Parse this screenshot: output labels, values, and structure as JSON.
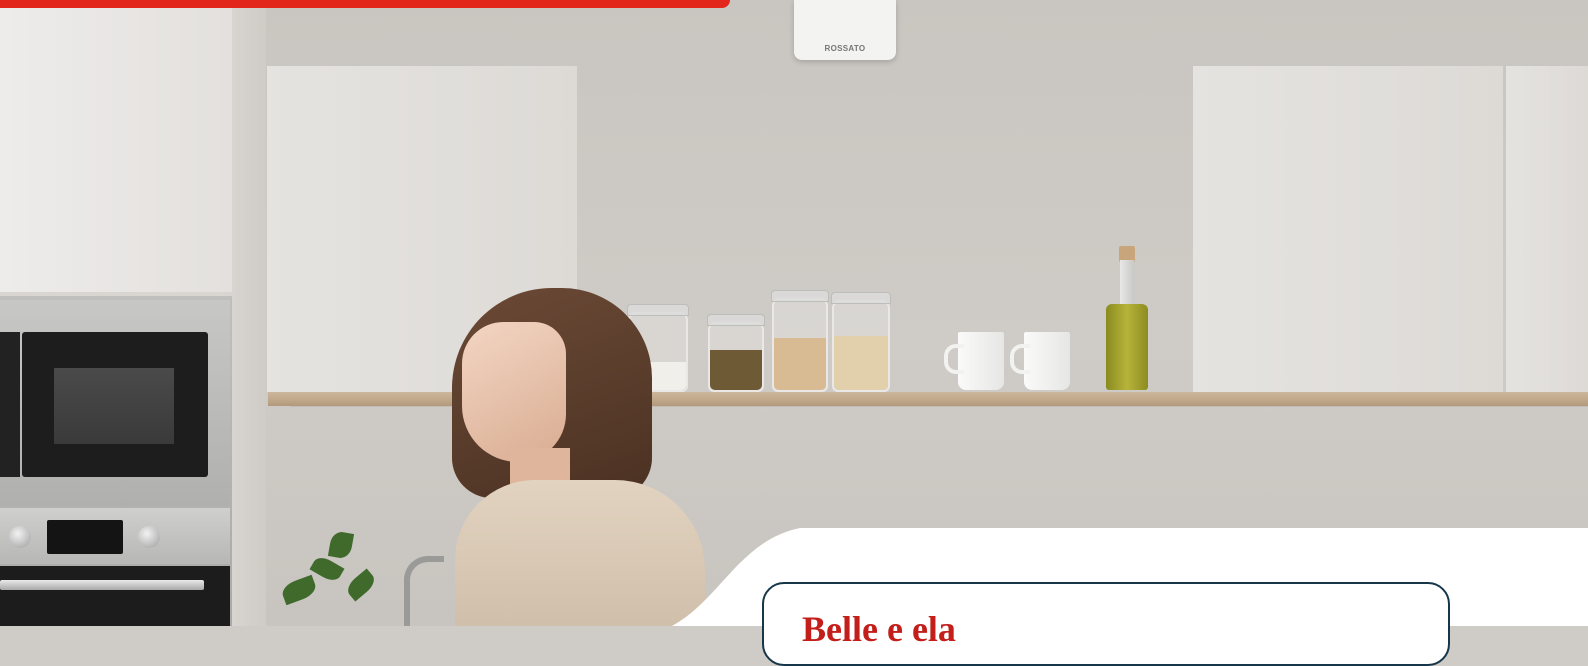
{
  "header": {
    "accent_color": "#e2261b"
  },
  "hero": {
    "device_brand": "ROSSATO",
    "card_title": "Belle e ela"
  },
  "colors": {
    "card_border": "#18364a",
    "card_title": "#c41e1a",
    "panel_bg": "#ffffff"
  }
}
